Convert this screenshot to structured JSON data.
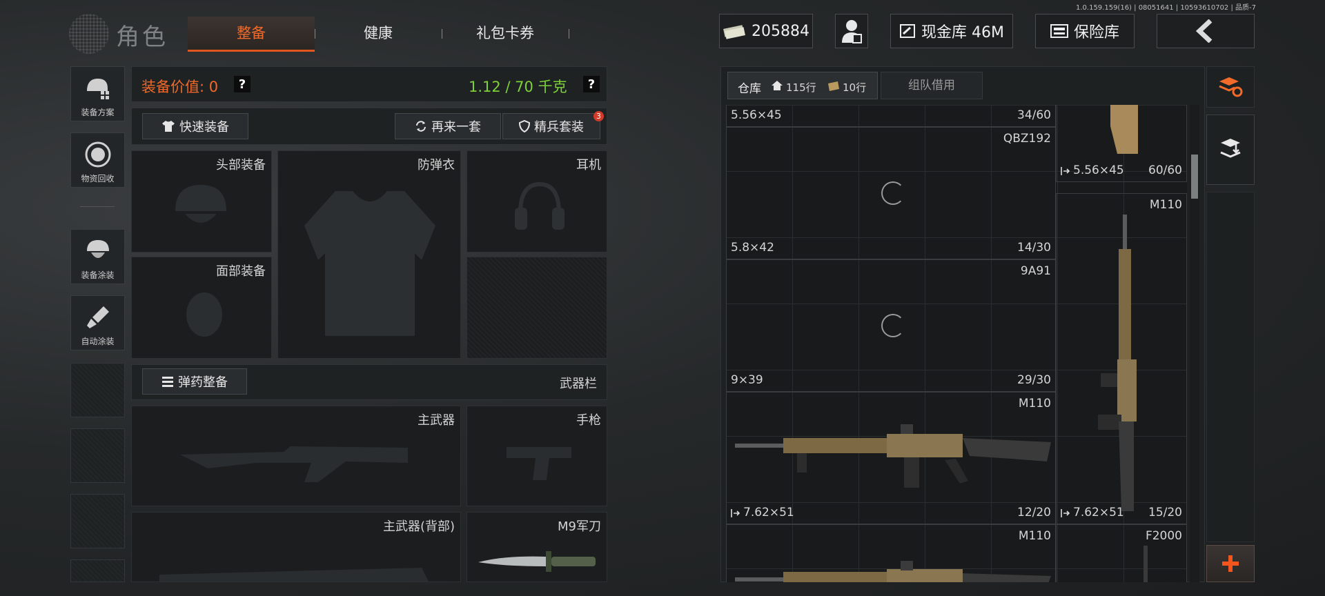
{
  "version": "1.0.159.159(16) | 08051641 | 10593610702 | 品质-7",
  "header": {
    "title": "角色",
    "tabs": [
      {
        "label": "整备",
        "active": true
      },
      {
        "label": "健康",
        "active": false
      },
      {
        "label": "礼包卡券",
        "active": false
      }
    ],
    "currency_value": "205884",
    "cash_vault": "现金库 46M",
    "safe_box": "保险库"
  },
  "sidebar": {
    "items": [
      {
        "label": "装备方案",
        "icon": "helmet-grid-icon"
      },
      {
        "label": "物资回收",
        "icon": "recycle-icon"
      },
      {
        "label": "装备涂装",
        "icon": "helmet-paint-icon"
      },
      {
        "label": "自动涂装",
        "icon": "brush-icon"
      }
    ]
  },
  "equipment": {
    "value_label": "装备价值: 0",
    "weight_label": "1.12 / 70 千克",
    "quick_equip": "快速装备",
    "another_set": "再来一套",
    "elite_set": "精兵套装",
    "elite_badge": "3",
    "slots": {
      "head": "头部装备",
      "armor": "防弹衣",
      "earphone": "耳机",
      "face": "面部装备",
      "primary": "主武器",
      "pistol": "手枪",
      "primary_back": "主武器(背部)",
      "knife": "M9军刀"
    },
    "ammo_button": "弹药整备",
    "weapon_bar": "武器栏"
  },
  "inventory": {
    "tab_warehouse": "仓库",
    "rows_home": "115行",
    "rows_bag": "10行",
    "tab_team": "组队借用",
    "cells": [
      {
        "name": "",
        "caliber": "5.56×45",
        "count": "34/60"
      },
      {
        "name": "QBZ192",
        "caliber": "5.8×42",
        "count": "14/30"
      },
      {
        "name": "9A91",
        "caliber": "9×39",
        "count": "29/30"
      },
      {
        "name": "M110",
        "caliber": "7.62×51",
        "count": "12/20"
      },
      {
        "name": "M110",
        "caliber": "",
        "count": ""
      },
      {
        "name": "",
        "caliber": "5.56×45",
        "count": "60/60"
      },
      {
        "name": "M110",
        "caliber": "7.62×51",
        "count": "15/20"
      },
      {
        "name": "F2000",
        "caliber": "",
        "count": ""
      }
    ]
  },
  "colors": {
    "accent": "#f26b2a",
    "weight_green": "#7ed13a",
    "badge_red": "#d23a2a"
  }
}
